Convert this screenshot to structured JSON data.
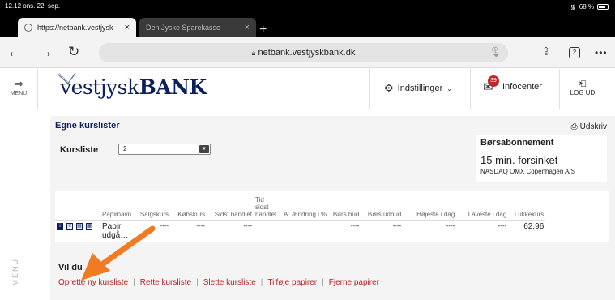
{
  "status": {
    "time": "12.12",
    "date": "ons. 22. sep.",
    "battery": "68 %"
  },
  "tabs": [
    {
      "title": "https://netbank.vestjysk"
    },
    {
      "title": "Den Jyske Sparekasse"
    }
  ],
  "address": {
    "url": "netbank.vestjyskbank.dk",
    "tab_count": "2"
  },
  "site": {
    "menu_label": "MENU",
    "logo": {
      "part1": "vestjysk",
      "part2": "BANK"
    },
    "settings_label": "Indstillinger",
    "info_label": "Infocenter",
    "info_badge": "39",
    "logout_label": "LOG UD"
  },
  "side_menu_label": "MENU",
  "panel": {
    "title": "Egne kurslister",
    "print_label": "Udskriv",
    "kursliste_label": "Kursliste",
    "kursliste_value": "2",
    "subscription": {
      "heading": "Børsabonnement",
      "delay": "15 min. forsinket",
      "exchange": "NASDAQ OMX Copenhagen A/S"
    },
    "table": {
      "headers": [
        "Papirnavn",
        "Salgskurs",
        "Købskurs",
        "Sidst handlet",
        "Tid sidst handlet",
        "A",
        "Ændring i %",
        "Børs bud",
        "Børs udbud",
        "Højeste i dag",
        "Laveste i dag",
        "Lukkekurs"
      ],
      "row": [
        "Papir udgå…",
        "----",
        "----",
        "----",
        "",
        "",
        "",
        "----",
        "----",
        "----",
        "----",
        "62,96"
      ]
    },
    "vil_du": "Vil du",
    "actions": [
      "Oprette ny kursliste",
      "Rette kursliste",
      "Slette kursliste",
      "Tilføje papirer",
      "Fjerne papirer"
    ]
  },
  "colors": {
    "brand_navy": "#0d1f5c",
    "link_red": "#b3242a",
    "annotation_orange": "#f07b22"
  }
}
